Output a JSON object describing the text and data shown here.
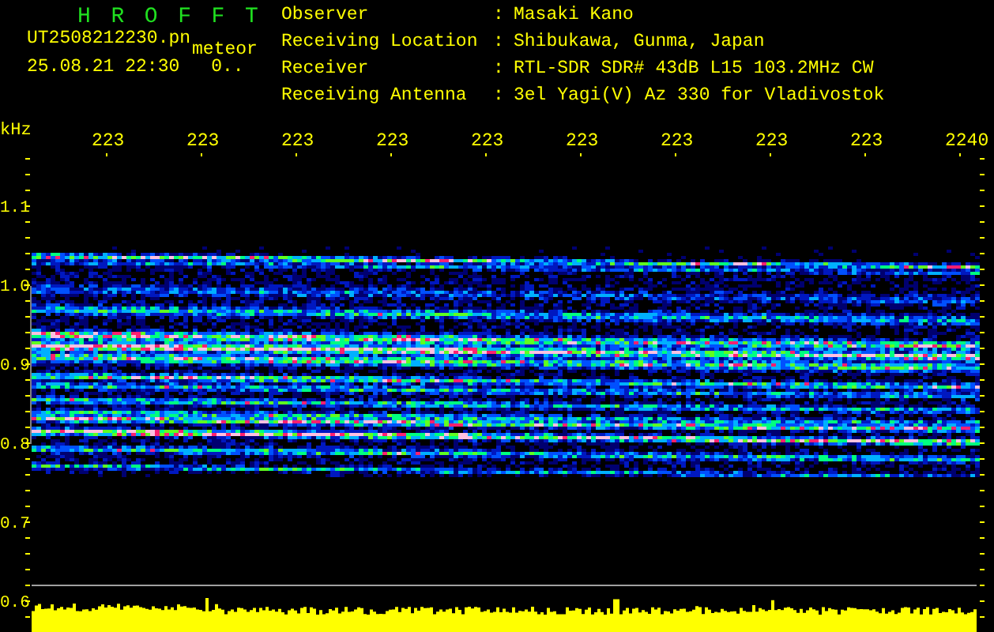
{
  "header": {
    "title": "H R O F F T",
    "filename": "UT2508212230.pn",
    "event_label": "meteor",
    "datetime": "25.08.21 22:30",
    "count": "0..",
    "info": [
      {
        "label": "Observer",
        "separator": ":",
        "value": "Masaki Kano"
      },
      {
        "label": "Receiving Location",
        "separator": ":",
        "value": "Shibukawa, Gunma, Japan"
      },
      {
        "label": "Receiver",
        "separator": ":",
        "value": "RTL-SDR SDR# 43dB L15 103.2MHz CW"
      },
      {
        "label": "Receiving Antenna",
        "separator": ":",
        "value": "3el Yagi(V) Az 330 for Vladivostok"
      }
    ]
  },
  "x_axis": {
    "unit": "kHz",
    "ticks": [
      "223",
      "223",
      "223",
      "223",
      "223",
      "223",
      "223",
      "223",
      "223",
      "2240"
    ]
  },
  "y_axis": {
    "ticks": [
      "1.1",
      "1.0",
      "0.9",
      "0.8",
      "0.7",
      "0.6"
    ]
  }
}
